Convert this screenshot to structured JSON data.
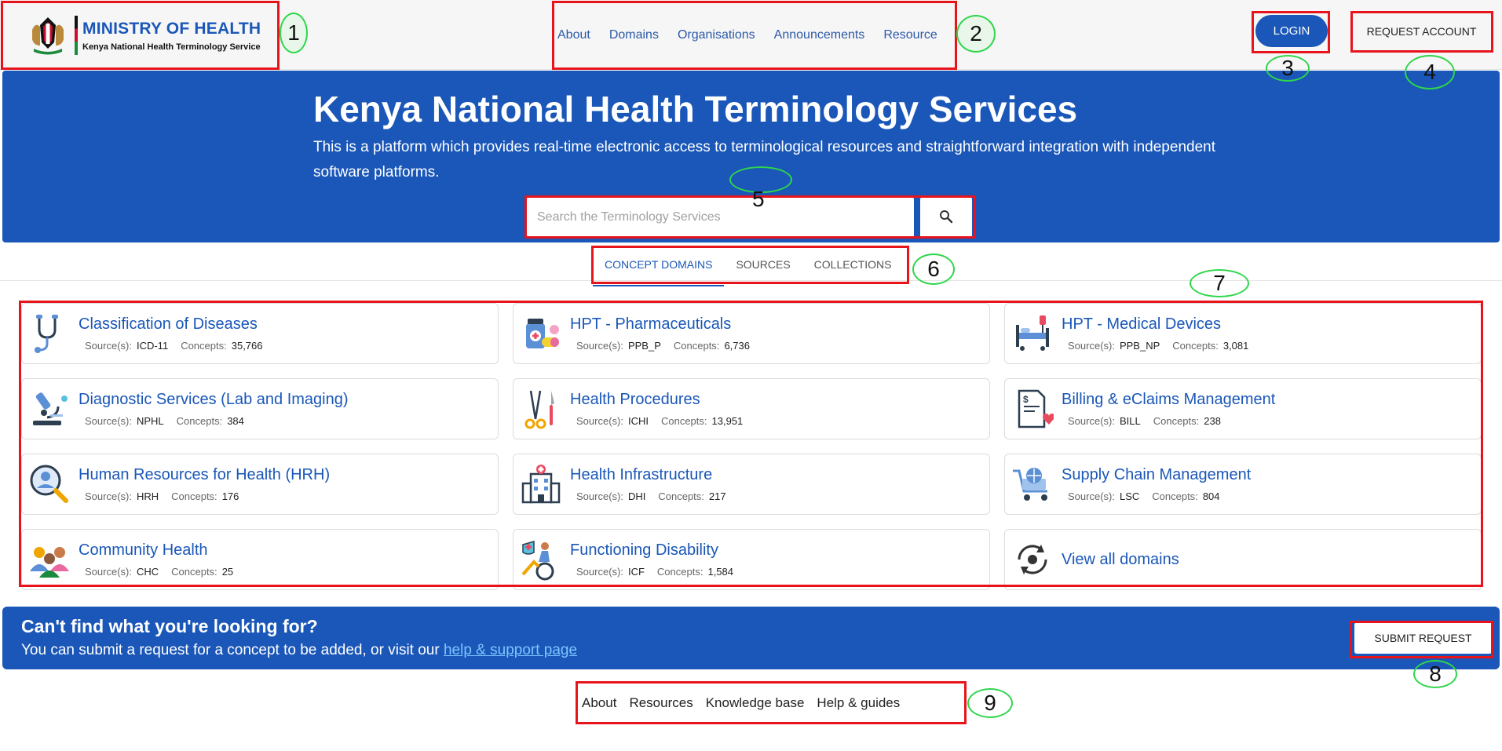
{
  "header": {
    "logo_line1": "MINISTRY OF HEALTH",
    "logo_line2": "Kenya National Health Terminology Service",
    "nav": [
      {
        "label": "About"
      },
      {
        "label": "Domains"
      },
      {
        "label": "Organisations"
      },
      {
        "label": "Announcements"
      },
      {
        "label": "Resource"
      }
    ],
    "login_label": "LOGIN",
    "request_account_label": "REQUEST ACCOUNT"
  },
  "hero": {
    "title": "Kenya National Health Terminology Services",
    "description": "This is a platform which provides real-time electronic access to terminological resources and straightforward integration with independent software platforms.",
    "search_placeholder": "Search the Terminology Services"
  },
  "tabs": [
    {
      "label": "CONCEPT DOMAINS",
      "active": true
    },
    {
      "label": "SOURCES",
      "active": false
    },
    {
      "label": "COLLECTIONS",
      "active": false
    }
  ],
  "domain_meta_labels": {
    "sources": "Source(s):",
    "concepts": "Concepts:"
  },
  "domains": [
    {
      "title": "Classification of Diseases",
      "source": "ICD-11",
      "concepts": "35,766",
      "icon": "stethoscope-icon"
    },
    {
      "title": "HPT - Pharmaceuticals",
      "source": "PPB_P",
      "concepts": "6,736",
      "icon": "pills-icon"
    },
    {
      "title": "HPT - Medical Devices",
      "source": "PPB_NP",
      "concepts": "3,081",
      "icon": "hospital-bed-icon"
    },
    {
      "title": "Diagnostic Services (Lab and Imaging)",
      "source": "NPHL",
      "concepts": "384",
      "icon": "microscope-icon"
    },
    {
      "title": "Health Procedures",
      "source": "ICHI",
      "concepts": "13,951",
      "icon": "surgical-tools-icon"
    },
    {
      "title": "Billing & eClaims Management",
      "source": "BILL",
      "concepts": "238",
      "icon": "invoice-icon"
    },
    {
      "title": "Human Resources for Health (HRH)",
      "source": "HRH",
      "concepts": "176",
      "icon": "hr-search-icon"
    },
    {
      "title": "Health Infrastructure",
      "source": "DHI",
      "concepts": "217",
      "icon": "hospital-building-icon"
    },
    {
      "title": "Supply Chain Management",
      "source": "LSC",
      "concepts": "804",
      "icon": "supply-cart-icon"
    },
    {
      "title": "Community Health",
      "source": "CHC",
      "concepts": "25",
      "icon": "community-icon"
    },
    {
      "title": "Functioning Disability",
      "source": "ICF",
      "concepts": "1,584",
      "icon": "wheelchair-icon"
    }
  ],
  "view_all_label": "View all domains",
  "request": {
    "title": "Can't find what you're looking for?",
    "text": "You can submit a request for a concept to be added, or visit our",
    "link_label": "help & support page",
    "button_label": "SUBMIT REQUEST"
  },
  "footer": [
    {
      "label": "About"
    },
    {
      "label": "Resources"
    },
    {
      "label": "Knowledge base"
    },
    {
      "label": "Help & guides"
    }
  ],
  "annotations": [
    "1",
    "2",
    "3",
    "4",
    "5",
    "6",
    "7",
    "8",
    "9"
  ],
  "colors": {
    "primary": "#1a57b8",
    "annotation_box": "#e8141c",
    "annotation_ring": "#2fd64b"
  }
}
